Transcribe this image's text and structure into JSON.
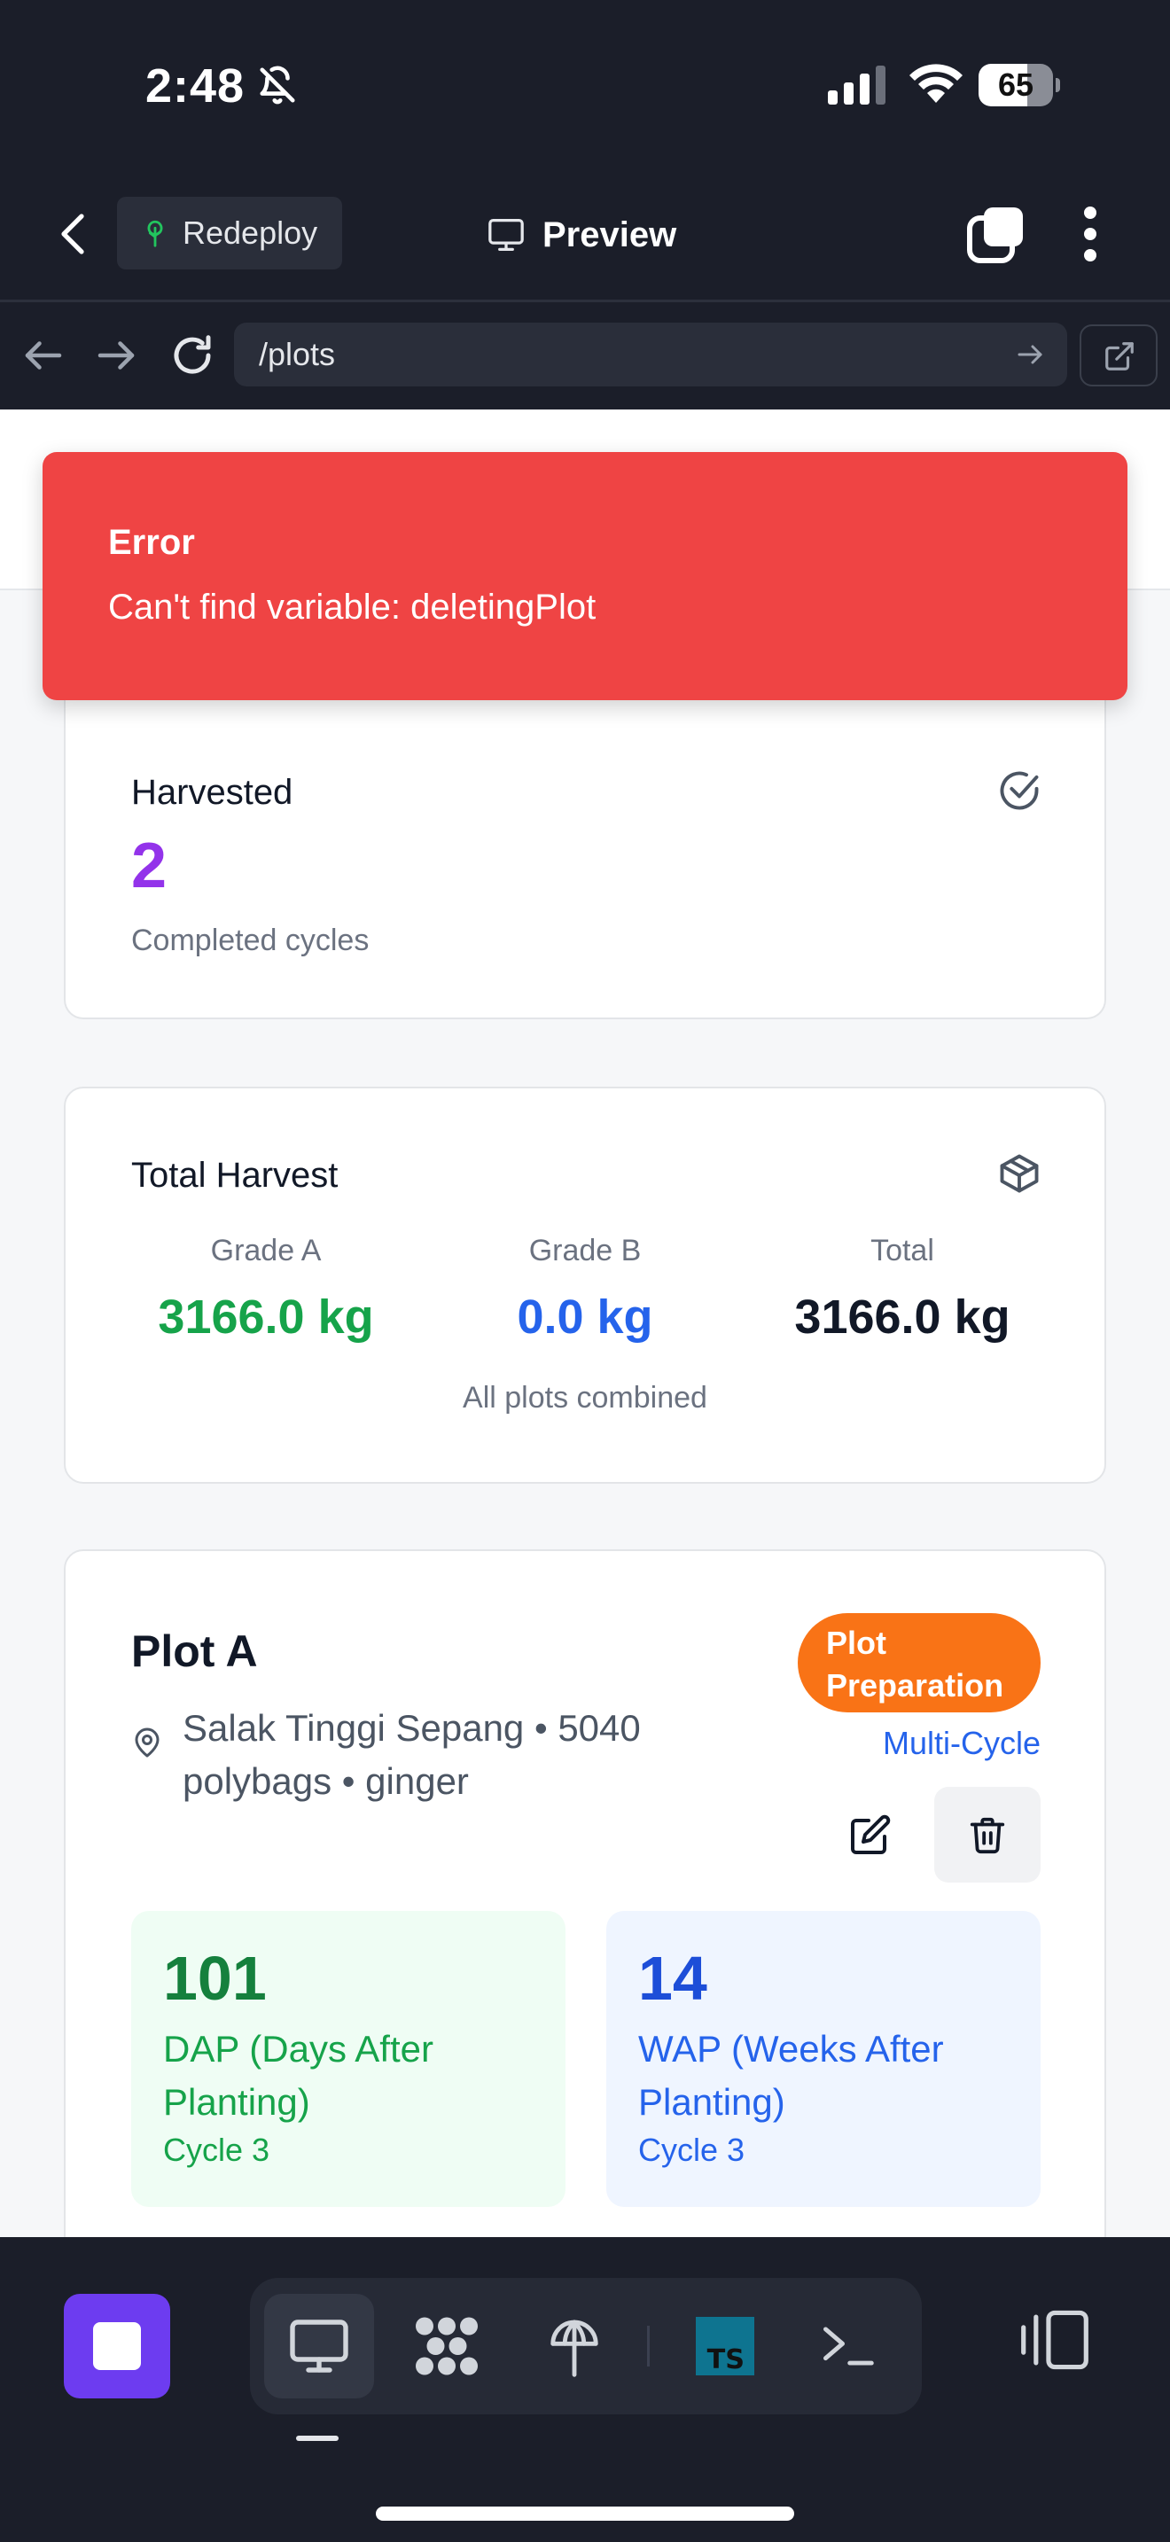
{
  "status_bar": {
    "time": "2:48",
    "battery": "65",
    "battery_fraction": 0.65
  },
  "nav": {
    "redeploy_label": "Redeploy",
    "preview_label": "Preview"
  },
  "browser": {
    "url": "/plots"
  },
  "error_toast": {
    "title": "Error",
    "message": "Can't find variable: deletingPlot"
  },
  "harvested_card": {
    "title": "Harvested",
    "value": "2",
    "subtitle": "Completed cycles"
  },
  "total_harvest_card": {
    "title": "Total Harvest",
    "grades": [
      {
        "label": "Grade A",
        "value": "3166.0 kg",
        "color": "#16a34a"
      },
      {
        "label": "Grade B",
        "value": "0.0 kg",
        "color": "#2563eb"
      },
      {
        "label": "Total",
        "value": "3166.0 kg",
        "color": "#111827"
      }
    ],
    "footer": "All plots combined"
  },
  "plot_card": {
    "name": "Plot A",
    "location": "Salak Tinggi Sepang • 5040 polybags • ginger",
    "status_badge": "Plot Preparation",
    "cycle_type": "Multi-Cycle",
    "dap": {
      "value": "101",
      "label": "DAP (Days After Planting)",
      "cycle": "Cycle 3"
    },
    "wap": {
      "value": "14",
      "label": "WAP (Weeks After Planting)",
      "cycle": "Cycle 3"
    }
  },
  "colors": {
    "accent_purple": "#9333ea",
    "error_red": "#ef4444",
    "badge_orange": "#f97316",
    "green": "#16a34a",
    "blue": "#2563eb"
  },
  "icons": {
    "harvested": "check-circle-icon",
    "total_harvest": "package-icon",
    "location": "map-pin-icon",
    "edit": "edit-icon",
    "delete": "trash-icon"
  }
}
